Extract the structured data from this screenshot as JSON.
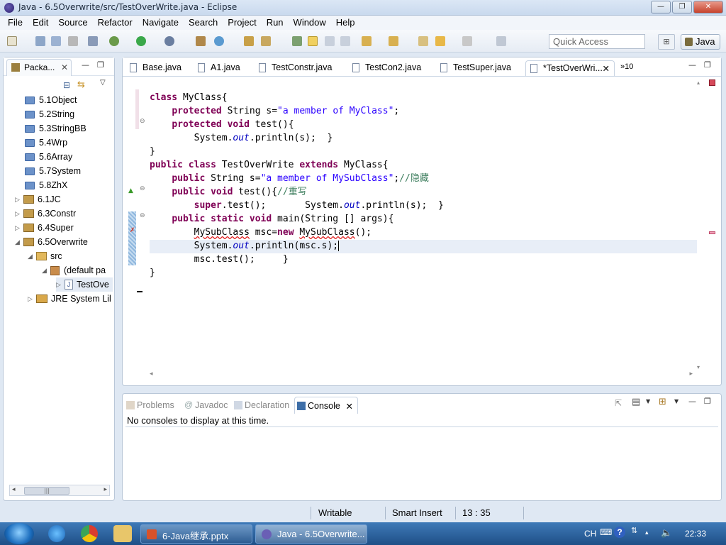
{
  "window": {
    "title": "Java - 6.5Overwrite/src/TestOverWrite.java - Eclipse",
    "minimize": "—",
    "maximize": "❐",
    "close": "✕"
  },
  "menu": [
    "File",
    "Edit",
    "Source",
    "Refactor",
    "Navigate",
    "Search",
    "Project",
    "Run",
    "Window",
    "Help"
  ],
  "toolbar": {
    "quick_access_placeholder": "Quick Access",
    "perspective": "Java"
  },
  "package_explorer": {
    "tab_label": "Packa...",
    "tree": [
      {
        "label": "5.1Object",
        "type": "folder"
      },
      {
        "label": "5.2String",
        "type": "folder"
      },
      {
        "label": "5.3StringBB",
        "type": "folder"
      },
      {
        "label": "5.4Wrp",
        "type": "folder"
      },
      {
        "label": "5.6Array",
        "type": "folder"
      },
      {
        "label": "5.7System",
        "type": "folder"
      },
      {
        "label": "5.8ZhX",
        "type": "folder"
      },
      {
        "label": "6.1JC",
        "type": "project"
      },
      {
        "label": "6.3Constr",
        "type": "project"
      },
      {
        "label": "6.4Super",
        "type": "project"
      },
      {
        "label": "6.5Overwrite",
        "type": "project"
      },
      {
        "label": "src",
        "type": "src"
      },
      {
        "label": "(default pa",
        "type": "package"
      },
      {
        "label": "TestOve",
        "type": "file"
      },
      {
        "label": "JRE System Lil",
        "type": "library"
      }
    ]
  },
  "editor": {
    "tabs": [
      "Base.java",
      "A1.java",
      "TestConstr.java",
      "TestCon2.java",
      "TestSuper.java",
      "*TestOverWri...",
      "»10"
    ],
    "active_tab": "*TestOverWri..."
  },
  "code": [
    "class MyClass{",
    "    protected String s=\"a member of MyClass\";",
    "    protected void test(){",
    "        System.out.println(s);  }",
    "}",
    "public class TestOverWrite extends MyClass{",
    "    public String s=\"a member of MySubClass\";//隐藏",
    "    public void test(){//重写",
    "        super.test();       System.out.println(s);  }",
    "    public static void main(String [] args){",
    "        MySubClass msc=new MySubClass();",
    "        System.out.println(msc.s);",
    "        msc.test();     }",
    "}"
  ],
  "console": {
    "tabs": [
      "Problems",
      "Javadoc",
      "Declaration",
      "Console"
    ],
    "active_tab": "Console",
    "message": "No consoles to display at this time."
  },
  "status": {
    "writable": "Writable",
    "insert_mode": "Smart Insert",
    "position": "13 : 35"
  },
  "taskbar": {
    "tasks": [
      "6-Java继承.pptx",
      "Java - 6.5Overwrite..."
    ],
    "ime": "CH",
    "time": "22:33"
  },
  "colors": {
    "keyword": "#7f0055",
    "string": "#2a00ff",
    "comment": "#3f7f5f",
    "static_field": "#0000c0",
    "current_line": "#e8eef7"
  }
}
